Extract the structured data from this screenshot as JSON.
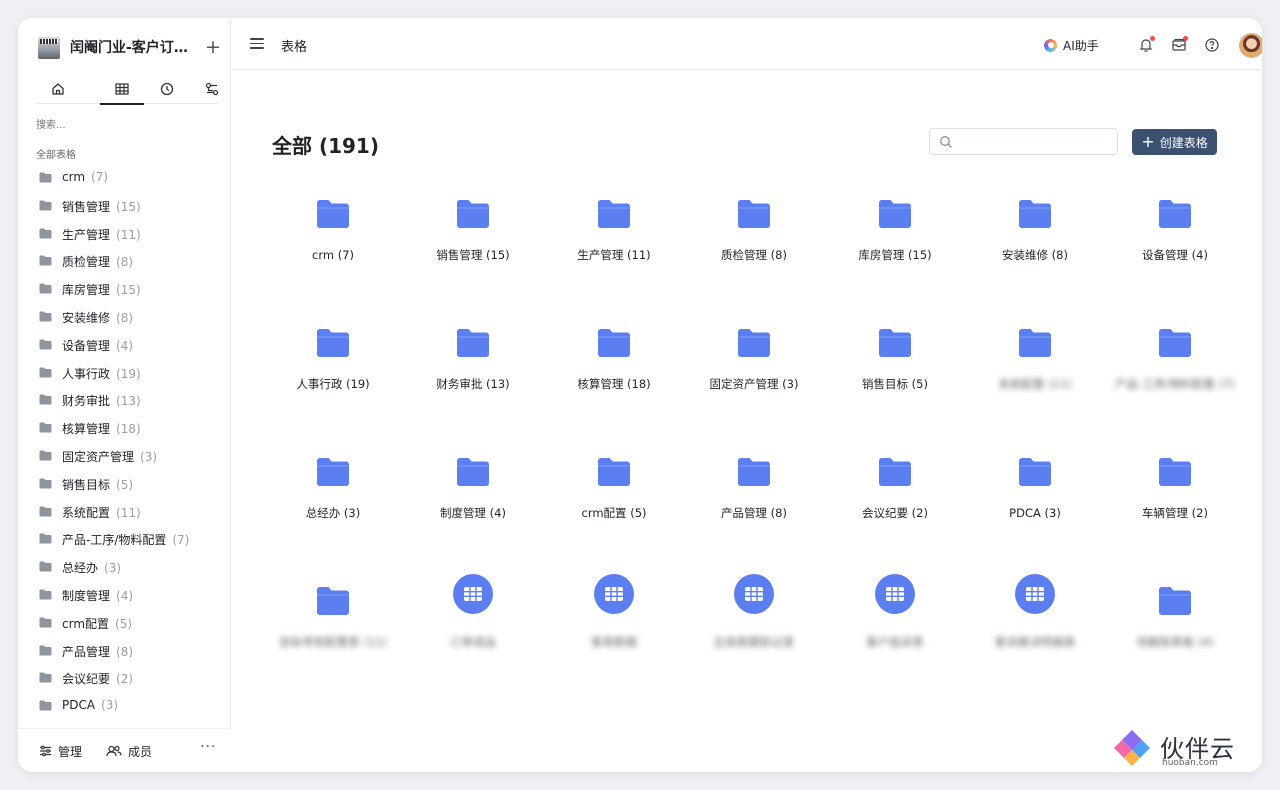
{
  "app": {
    "title": "闰阉门业-客户订单..."
  },
  "sidebar": {
    "tabs": [
      {
        "icon": "home-icon"
      },
      {
        "icon": "table-grid-icon",
        "active": true
      },
      {
        "icon": "clock-icon"
      },
      {
        "icon": "workflow-icon"
      }
    ],
    "search_placeholder": "搜索...",
    "section_label": "全部表格",
    "items": [
      {
        "label": "crm",
        "count": "(7)"
      },
      {
        "label": "销售管理",
        "count": "(15)"
      },
      {
        "label": "生产管理",
        "count": "(11)"
      },
      {
        "label": "质检管理",
        "count": "(8)"
      },
      {
        "label": "库房管理",
        "count": "(15)"
      },
      {
        "label": "安装维修",
        "count": "(8)"
      },
      {
        "label": "设备管理",
        "count": "(4)"
      },
      {
        "label": "人事行政",
        "count": "(19)"
      },
      {
        "label": "财务审批",
        "count": "(13)"
      },
      {
        "label": "核算管理",
        "count": "(18)"
      },
      {
        "label": "固定资产管理",
        "count": "(3)"
      },
      {
        "label": "销售目标",
        "count": "(5)"
      },
      {
        "label": "系统配置",
        "count": "(11)"
      },
      {
        "label": "产品-工序/物料配置",
        "count": "(7)"
      },
      {
        "label": "总经办",
        "count": "(3)"
      },
      {
        "label": "制度管理",
        "count": "(4)"
      },
      {
        "label": "crm配置",
        "count": "(5)"
      },
      {
        "label": "产品管理",
        "count": "(8)"
      },
      {
        "label": "会议纪要",
        "count": "(2)"
      },
      {
        "label": "PDCA",
        "count": "(3)"
      }
    ],
    "footer": {
      "manage_label": "管理",
      "members_label": "成员",
      "more_label": "···"
    }
  },
  "topbar": {
    "title": "表格",
    "ai_label": "AI助手"
  },
  "main": {
    "title": "全部 (191)",
    "search_placeholder": "",
    "create_label": "创建表格",
    "items": [
      {
        "name": "crm (7)",
        "type": "folder"
      },
      {
        "name": "销售管理 (15)",
        "type": "folder"
      },
      {
        "name": "生产管理 (11)",
        "type": "folder"
      },
      {
        "name": "质检管理 (8)",
        "type": "folder"
      },
      {
        "name": "库房管理 (15)",
        "type": "folder"
      },
      {
        "name": "安装维修 (8)",
        "type": "folder"
      },
      {
        "name": "设备管理 (4)",
        "type": "folder"
      },
      {
        "name": "人事行政 (19)",
        "type": "folder"
      },
      {
        "name": "财务审批 (13)",
        "type": "folder"
      },
      {
        "name": "核算管理 (18)",
        "type": "folder"
      },
      {
        "name": "固定资产管理 (3)",
        "type": "folder"
      },
      {
        "name": "销售目标 (5)",
        "type": "folder"
      },
      {
        "name": "系统配置 (11)",
        "type": "folder",
        "blurred": true
      },
      {
        "name": "产品-工序/物料配置 (7)",
        "type": "folder",
        "blurred": true
      },
      {
        "name": "总经办 (3)",
        "type": "folder"
      },
      {
        "name": "制度管理 (4)",
        "type": "folder"
      },
      {
        "name": "crm配置 (5)",
        "type": "folder"
      },
      {
        "name": "产品管理 (8)",
        "type": "folder"
      },
      {
        "name": "会议纪要 (2)",
        "type": "folder"
      },
      {
        "name": "PDCA (3)",
        "type": "folder"
      },
      {
        "name": "车辆管理 (2)",
        "type": "folder"
      },
      {
        "name": "目标考核配置表 (11)",
        "type": "folder",
        "blurred": true
      },
      {
        "name": "订单成品",
        "type": "table",
        "blurred": true
      },
      {
        "name": "客商数据",
        "type": "table",
        "blurred": true
      },
      {
        "name": "应收款跟踪记录",
        "type": "table",
        "blurred": true
      },
      {
        "name": "客户投诉表",
        "type": "table",
        "blurred": true
      },
      {
        "name": "客诉解决明细表",
        "type": "table",
        "blurred": true
      },
      {
        "name": "待删除表格 (4)",
        "type": "folder",
        "blurred": true
      }
    ]
  },
  "brand": {
    "name": "伙伴云",
    "url": "huoban.com"
  },
  "colors": {
    "folder": "#5b7ff0",
    "primary_button": "#3b5170",
    "notification_dot": "#f54a45"
  }
}
